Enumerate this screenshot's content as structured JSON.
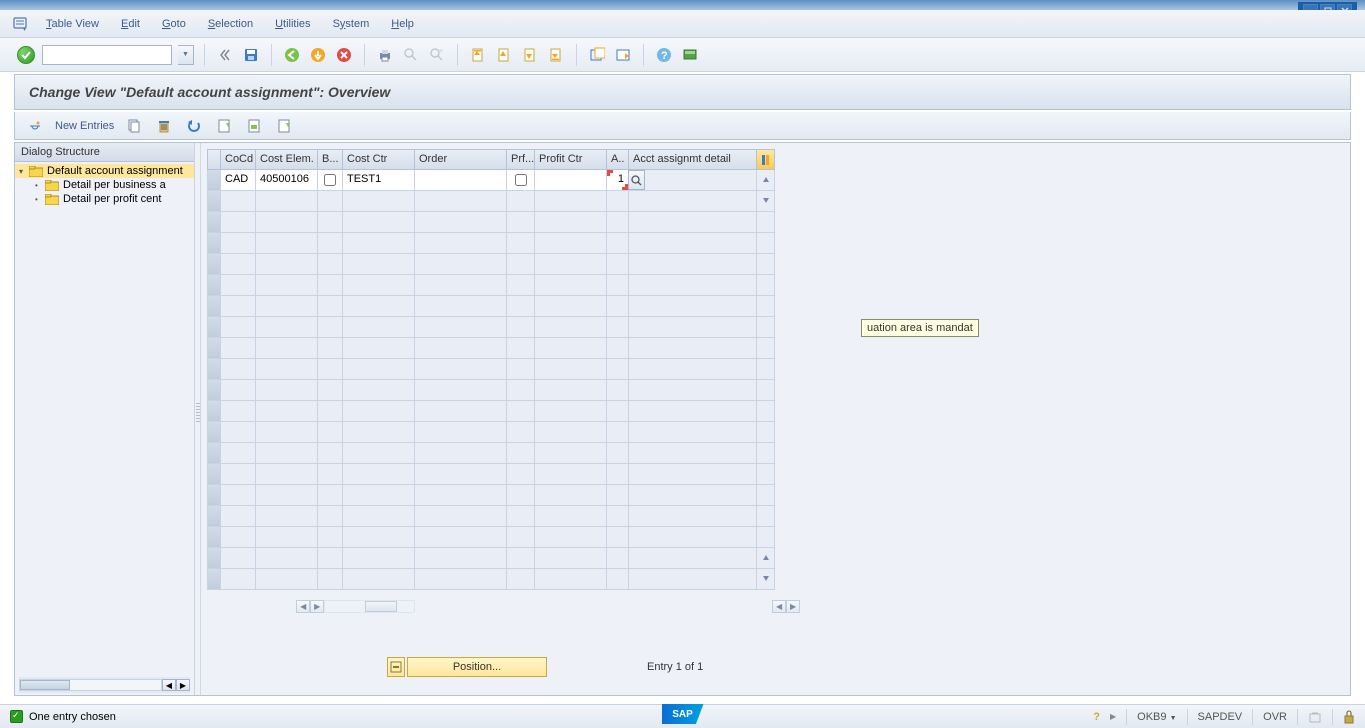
{
  "menubar": {
    "items": [
      {
        "label": "Table View",
        "ul": "T"
      },
      {
        "label": "Edit",
        "ul": "E"
      },
      {
        "label": "Goto",
        "ul": "G"
      },
      {
        "label": "Selection",
        "ul": "S"
      },
      {
        "label": "Utilities",
        "ul": "U"
      },
      {
        "label": "System",
        "ul": "y"
      },
      {
        "label": "Help",
        "ul": "H"
      }
    ]
  },
  "title": "Change View \"Default account assignment\": Overview",
  "toolbar2": {
    "new_entries": "New Entries"
  },
  "tree": {
    "header": "Dialog Structure",
    "nodes": [
      {
        "label": "Default account assignment",
        "selected": true,
        "level": 0,
        "open": true
      },
      {
        "label": "Detail per business area/valuation area",
        "selected": false,
        "level": 1,
        "open": false
      },
      {
        "label": "Detail per profit center",
        "selected": false,
        "level": 1,
        "open": false
      }
    ]
  },
  "grid": {
    "columns": [
      {
        "label": "",
        "w": 14
      },
      {
        "label": "CoCd",
        "w": 35
      },
      {
        "label": "Cost Elem.",
        "w": 62
      },
      {
        "label": "B...",
        "w": 25
      },
      {
        "label": "Cost Ctr",
        "w": 72
      },
      {
        "label": "Order",
        "w": 92
      },
      {
        "label": "Prf...",
        "w": 28
      },
      {
        "label": "Profit Ctr",
        "w": 72
      },
      {
        "label": "A..",
        "w": 22
      },
      {
        "label": "Acct assignmt detail",
        "w": 128
      }
    ],
    "row": {
      "cocd": "CAD",
      "costelem": "40500106",
      "costctr": "TEST1",
      "order": "",
      "profitctr": "",
      "a": "1"
    },
    "tooltip": "uation area is mandat"
  },
  "position": {
    "btn": "Position...",
    "entry": "Entry 1 of 1"
  },
  "statusbar": {
    "msg": "One entry chosen",
    "tcode": "OKB9",
    "system": "SAPDEV",
    "mode": "OVR"
  }
}
